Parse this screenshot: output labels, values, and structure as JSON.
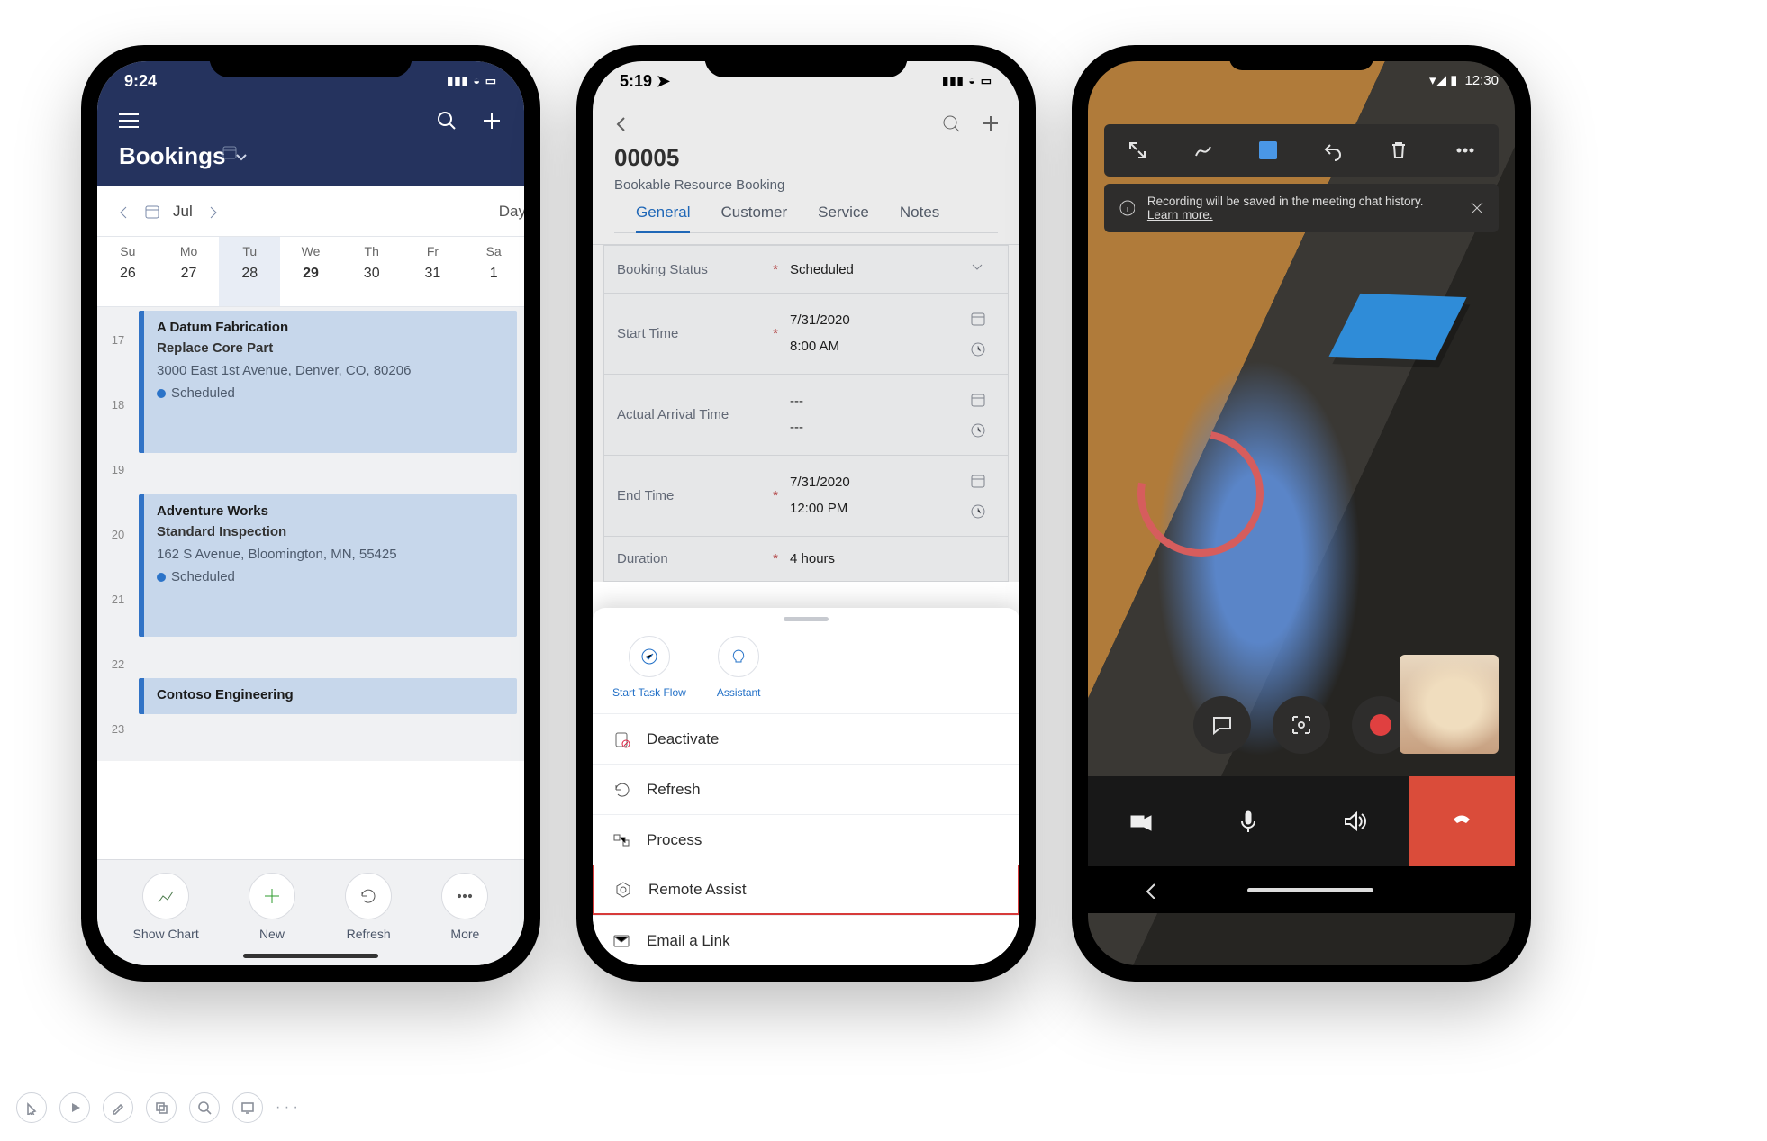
{
  "phone1": {
    "status_time": "9:24",
    "header_title": "Bookings",
    "subbar": {
      "month": "Jul",
      "view": "Day"
    },
    "week": {
      "labels": [
        "Su",
        "Mo",
        "Tu",
        "We",
        "Th",
        "Fr",
        "Sa"
      ],
      "nums": [
        "26",
        "27",
        "28",
        "29",
        "30",
        "31",
        "1"
      ],
      "selected_index": 2,
      "bold_index": 3
    },
    "hours": [
      "17",
      "18",
      "19",
      "20",
      "21",
      "22",
      "23"
    ],
    "events": [
      {
        "title": "A Datum Fabrication",
        "sub": "Replace Core Part",
        "addr": "3000 East 1st Avenue, Denver, CO, 80206",
        "status": "Scheduled"
      },
      {
        "title": "Adventure Works",
        "sub": "Standard Inspection",
        "addr": "162 S Avenue, Bloomington, MN, 55425",
        "status": "Scheduled"
      },
      {
        "title": "Contoso Engineering",
        "sub": "",
        "addr": "",
        "status": ""
      }
    ],
    "bottom": {
      "show_chart": "Show Chart",
      "new": "New",
      "refresh": "Refresh",
      "more": "More"
    }
  },
  "phone2": {
    "status_time": "5:19",
    "record_id": "00005",
    "entity": "Bookable Resource Booking",
    "tabs": [
      "General",
      "Customer",
      "Service",
      "Notes"
    ],
    "active_tab": 0,
    "form": {
      "booking_status_label": "Booking Status",
      "booking_status_value": "Scheduled",
      "start_label": "Start Time",
      "start_date": "7/31/2020",
      "start_time": "8:00 AM",
      "arrival_label": "Actual Arrival Time",
      "arrival_v1": "---",
      "arrival_v2": "---",
      "end_label": "End Time",
      "end_date": "7/31/2020",
      "end_time": "12:00 PM",
      "duration_label": "Duration",
      "duration_value": "4 hours"
    },
    "sheet": {
      "start_task": "Start Task Flow",
      "assistant": "Assistant",
      "items": [
        "Deactivate",
        "Refresh",
        "Process",
        "Remote Assist",
        "Email a Link"
      ],
      "highlighted_index": 3
    }
  },
  "phone3": {
    "status_time": "12:30",
    "banner_text": "Recording will be saved in the meeting chat history.",
    "banner_link": "Learn more."
  }
}
